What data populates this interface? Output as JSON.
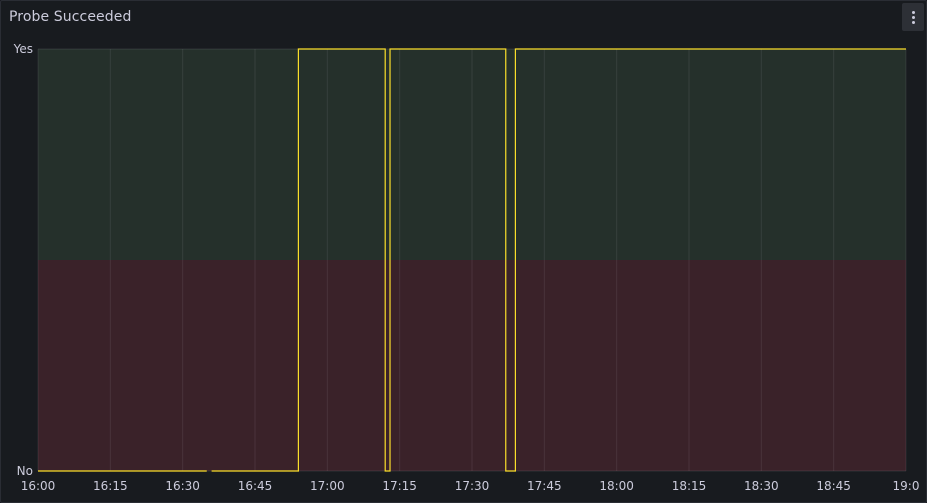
{
  "panel": {
    "title": "Probe Succeeded",
    "menu_icon": "ellipsis-vertical-icon"
  },
  "chart_data": {
    "type": "line",
    "line_style": "step-after",
    "series": [
      {
        "color": "#fade2a",
        "segments": [
          {
            "x": [
              "16:00",
              "16:35"
            ],
            "y": [
              0,
              0
            ]
          },
          {
            "x": [
              "16:36",
              "16:54",
              "16:54",
              "17:12",
              "17:12",
              "17:13",
              "17:13",
              "17:37",
              "17:37",
              "17:39",
              "17:39",
              "19:00"
            ],
            "y": [
              0,
              0,
              1,
              1,
              0,
              0,
              1,
              1,
              0,
              0,
              1,
              1
            ]
          }
        ]
      }
    ],
    "x_ticks": [
      "16:00",
      "16:15",
      "16:30",
      "16:45",
      "17:00",
      "17:15",
      "17:30",
      "17:45",
      "18:00",
      "18:15",
      "18:30",
      "18:45",
      "19:0"
    ],
    "x_range": [
      "16:00",
      "19:00"
    ],
    "y_ticks": [
      {
        "value": 1,
        "label": "Yes"
      },
      {
        "value": 0,
        "label": "No"
      }
    ],
    "y_range": [
      0,
      1
    ],
    "thresholds": [
      {
        "from": 0,
        "to": 0.5,
        "color": "#3a2229"
      },
      {
        "from": 0.5,
        "to": 1,
        "color": "#25302b"
      }
    ],
    "grid": true,
    "legend": "none"
  }
}
